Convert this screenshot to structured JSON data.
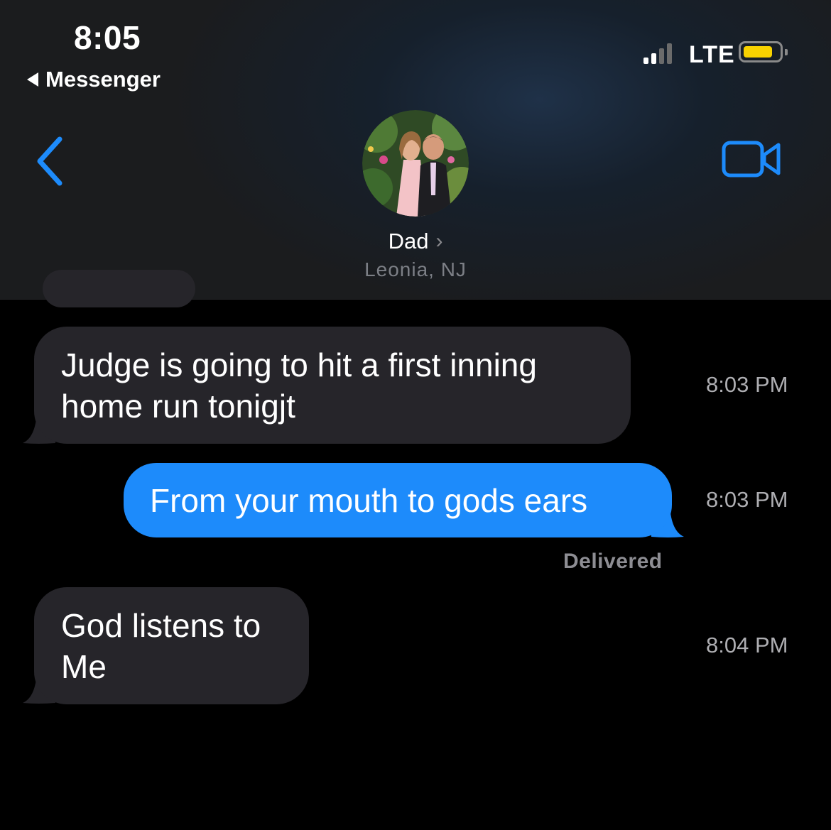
{
  "status_bar": {
    "time": "8:05",
    "back_app": "Messenger",
    "network": "LTE",
    "battery_color": "#f8d200"
  },
  "conversation_header": {
    "contact_name": "Dad",
    "contact_location": "Leonia, NJ",
    "back_icon": "chevron-left-icon",
    "video_icon": "video-camera-icon",
    "accent_color": "#1d8bfb"
  },
  "messages": [
    {
      "direction": "incoming",
      "text_lines": [
        "Judge is going to hit a first inning",
        "home run tonigjt"
      ],
      "time": "8:03 PM"
    },
    {
      "direction": "outgoing",
      "text_lines": [
        "From your mouth to gods ears"
      ],
      "time": "8:03 PM",
      "status": "Delivered"
    },
    {
      "direction": "incoming",
      "text_lines": [
        "God listens to",
        "Me"
      ],
      "time": "8:04 PM"
    }
  ]
}
